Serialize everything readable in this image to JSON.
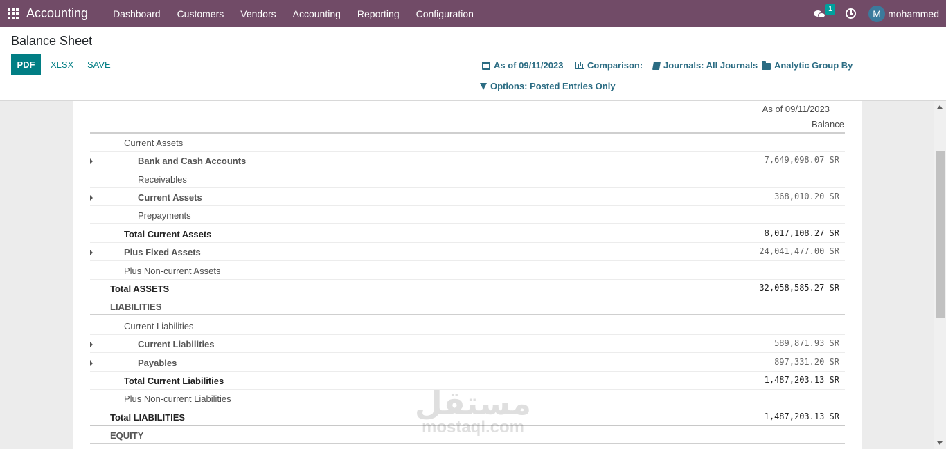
{
  "navbar": {
    "brand": "Accounting",
    "menu": [
      "Dashboard",
      "Customers",
      "Vendors",
      "Accounting",
      "Reporting",
      "Configuration"
    ],
    "chat_count": "1",
    "avatar_initial": "M",
    "username": "mohammed",
    "bg_color": "#714b67"
  },
  "control": {
    "title": "Balance Sheet",
    "buttons": {
      "pdf": "PDF",
      "xlsx": "XLSX",
      "save": "SAVE"
    },
    "filters": {
      "date": "As of 09/11/2023",
      "comparison": "Comparison:",
      "journals": "Journals: All Journals",
      "analytic": "Analytic Group By",
      "options": "Options: Posted Entries Only"
    },
    "accent_color": "#017e84"
  },
  "report": {
    "column_date": "As of 09/11/2023",
    "column_label": "Balance",
    "rows": [
      {
        "label": "Current Assets",
        "amount": ""
      },
      {
        "label": "Bank and Cash Accounts",
        "amount": "7,649,098.07 SR"
      },
      {
        "label": "Receivables",
        "amount": ""
      },
      {
        "label": "Current Assets",
        "amount": "368,010.20 SR"
      },
      {
        "label": "Prepayments",
        "amount": ""
      },
      {
        "label": "Total Current Assets",
        "amount": "8,017,108.27 SR"
      },
      {
        "label": "Plus Fixed Assets",
        "amount": "24,041,477.00 SR"
      },
      {
        "label": "Plus Non-current Assets",
        "amount": ""
      },
      {
        "label": "Total ASSETS",
        "amount": "32,058,585.27 SR"
      },
      {
        "label": "LIABILITIES",
        "amount": ""
      },
      {
        "label": "Current Liabilities",
        "amount": ""
      },
      {
        "label": "Current Liabilities",
        "amount": "589,871.93 SR"
      },
      {
        "label": "Payables",
        "amount": "897,331.20 SR"
      },
      {
        "label": "Total Current Liabilities",
        "amount": "1,487,203.13 SR"
      },
      {
        "label": "Plus Non-current Liabilities",
        "amount": ""
      },
      {
        "label": "Total LIABILITIES",
        "amount": "1,487,203.13 SR"
      },
      {
        "label": "EQUITY",
        "amount": ""
      }
    ]
  },
  "watermark": {
    "arabic": "مستقل",
    "latin": "mostaql.com"
  }
}
